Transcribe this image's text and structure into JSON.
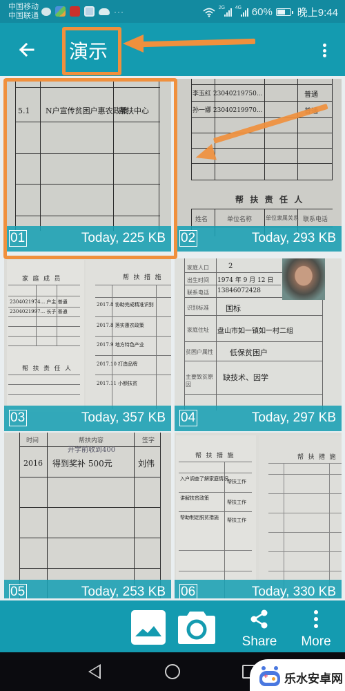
{
  "status_bar": {
    "carrier_1": "中国移动",
    "carrier_2": "中国联通",
    "notification_icons": [
      "wechat-icon",
      "app-icon",
      "news-app-icon",
      "link-app-icon",
      "weather-icon"
    ],
    "overflow_dots": "···",
    "network_1_label": "2G",
    "network_2_label": "4G",
    "battery_percent_text": "60%",
    "battery_level": 0.6,
    "time": "晚上9:44"
  },
  "app_bar": {
    "back_icon": "←",
    "title": "演示",
    "overflow_icon": "more-vert"
  },
  "annotations": {
    "highlight_color": "#f0903d",
    "title_callout": "arrow pointing to title",
    "item_callout": "arrow pointing to first item"
  },
  "items": [
    {
      "index": "01",
      "date": "Today",
      "size": "225 KB",
      "meta": "Today, 225 KB",
      "highlighted": true
    },
    {
      "index": "02",
      "date": "Today",
      "size": "293 KB",
      "meta": "Today, 293 KB",
      "doc_heading": "帮 扶 责 任 人",
      "doc_columns": [
        "姓名",
        "单位名称",
        "单位隶属关系",
        "联系电话"
      ]
    },
    {
      "index": "03",
      "date": "Today",
      "size": "357 KB",
      "meta": "Today, 357 KB",
      "doc_heading_left": "家 庭 成 员",
      "doc_heading_left_2": "帮 扶 责 任 人",
      "doc_heading_right": "帮 扶 措 施"
    },
    {
      "index": "04",
      "date": "Today",
      "size": "297 KB",
      "meta": "Today, 297 KB",
      "doc_fields": [
        {
          "label": "家庭人口",
          "value": "2"
        },
        {
          "label": "出生时间",
          "value": "1974 年 9 月 12 日"
        },
        {
          "label": "联系电话",
          "value": "13846072428"
        },
        {
          "label": "识别标准",
          "value": "国标"
        },
        {
          "label": "家庭住址",
          "value": "盘山市如一镇如一村二组"
        },
        {
          "label": "贫困户属性",
          "value": "低保贫困户"
        },
        {
          "label": "主要致贫原因",
          "value": "缺技术、因学"
        }
      ]
    },
    {
      "index": "05",
      "date": "Today",
      "size": "253 KB",
      "meta": "Today, 253 KB",
      "doc_columns": [
        "时间",
        "帮扶内容",
        "签字"
      ]
    },
    {
      "index": "06",
      "date": "Today",
      "size": "330 KB",
      "meta": "Today, 330 KB",
      "doc_heading_left": "帮 扶 措 施",
      "doc_heading_right": "帮 扶 措 施"
    }
  ],
  "bottom_bar": {
    "gallery_icon": "image-icon",
    "camera_icon": "camera-icon",
    "share_label": "Share",
    "more_label": "More"
  },
  "nav_bar": {
    "back": "nav-back",
    "home": "nav-home",
    "recents": "nav-recents"
  },
  "watermark": {
    "text": "乐水安卓网"
  },
  "colors": {
    "primary": "#149bb0",
    "status_bar": "#138aa0",
    "caption_overlay": "#1aa0b4",
    "accent_annotation": "#f0903d",
    "nav_bar": "#0b0b0f"
  }
}
